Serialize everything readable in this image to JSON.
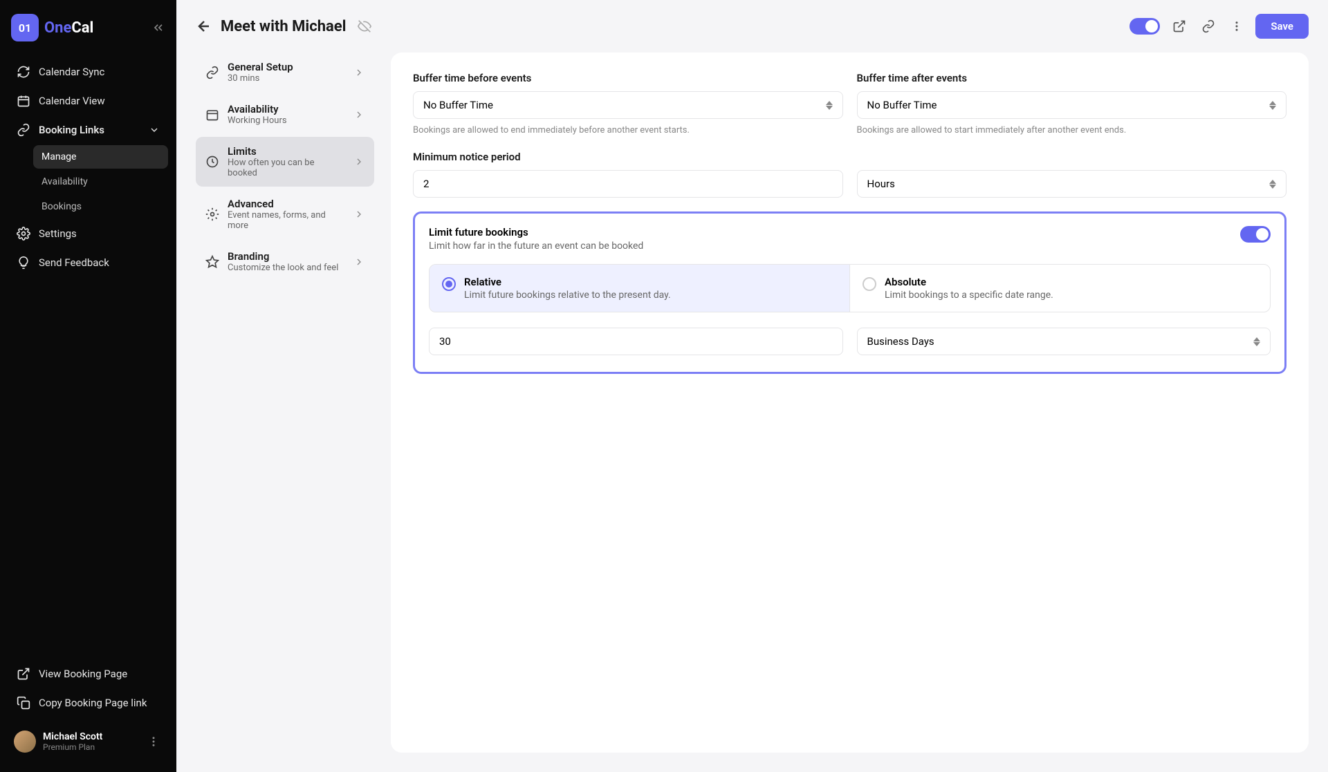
{
  "brand": {
    "icon_text": "01",
    "name_a": "One",
    "name_b": "Cal"
  },
  "sidebar": {
    "items": [
      {
        "label": "Calendar Sync"
      },
      {
        "label": "Calendar View"
      },
      {
        "label": "Booking Links"
      }
    ],
    "booking_sub": [
      {
        "label": "Manage"
      },
      {
        "label": "Availability"
      },
      {
        "label": "Bookings"
      }
    ],
    "items2": [
      {
        "label": "Settings"
      },
      {
        "label": "Send Feedback"
      }
    ],
    "bottom": [
      {
        "label": "View Booking Page"
      },
      {
        "label": "Copy Booking Page link"
      }
    ]
  },
  "user": {
    "name": "Michael Scott",
    "plan": "Premium Plan"
  },
  "header": {
    "title": "Meet with Michael",
    "save": "Save"
  },
  "settings_nav": [
    {
      "title": "General Setup",
      "sub": "30 mins"
    },
    {
      "title": "Availability",
      "sub": "Working Hours"
    },
    {
      "title": "Limits",
      "sub": "How often you can be booked"
    },
    {
      "title": "Advanced",
      "sub": "Event names, forms, and more"
    },
    {
      "title": "Branding",
      "sub": "Customize the look and feel"
    }
  ],
  "panel": {
    "buffer_before": {
      "label": "Buffer time before events",
      "value": "No Buffer Time",
      "helper": "Bookings are allowed to end immediately before another event starts."
    },
    "buffer_after": {
      "label": "Buffer time after events",
      "value": "No Buffer Time",
      "helper": "Bookings are allowed to start immediately after another event ends."
    },
    "min_notice": {
      "label": "Minimum notice period",
      "value": "2",
      "unit": "Hours"
    },
    "limit_future": {
      "title": "Limit future bookings",
      "sub": "Limit how far in the future an event can be booked",
      "relative": {
        "title": "Relative",
        "sub": "Limit future bookings relative to the present day."
      },
      "absolute": {
        "title": "Absolute",
        "sub": "Limit bookings to a specific date range."
      },
      "value": "30",
      "unit": "Business Days"
    }
  }
}
